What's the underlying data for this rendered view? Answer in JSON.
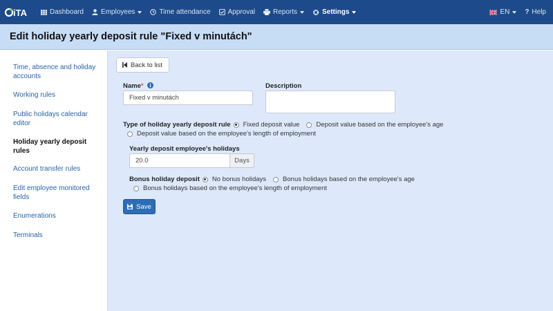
{
  "nav": {
    "logo_text": "CiTA",
    "items": [
      {
        "label": "Dashboard"
      },
      {
        "label": "Employees"
      },
      {
        "label": "Time attendance"
      },
      {
        "label": "Approval"
      },
      {
        "label": "Reports"
      },
      {
        "label": "Settings"
      }
    ],
    "language": "EN",
    "help": "Help"
  },
  "header": {
    "title": "Edit holiday yearly deposit rule \"Fixed v minutách\""
  },
  "sidebar": {
    "items": [
      {
        "label": "Time, absence and holiday accounts"
      },
      {
        "label": "Working rules"
      },
      {
        "label": "Public holidays calendar editor"
      },
      {
        "label": "Holiday yearly deposit rules"
      },
      {
        "label": "Account transfer rules"
      },
      {
        "label": "Edit employee monitored fields"
      },
      {
        "label": "Enumerations"
      },
      {
        "label": "Terminals"
      }
    ]
  },
  "form": {
    "back_label": "Back to list",
    "name_label": "Name",
    "required_mark": "*",
    "name_value": "Fixed v minutách",
    "description_label": "Description",
    "description_value": "",
    "rule_type_label": "Type of holiday yearly deposit rule",
    "rule_type_options": [
      "Fixed deposit value",
      "Deposit value based on the employee's age",
      "Deposit value based on the employee's length of employment"
    ],
    "rule_type_selected": 0,
    "yearly_label": "Yearly deposit employee's holidays",
    "yearly_value": "20.0",
    "yearly_unit": "Days",
    "bonus_label": "Bonus holiday deposit",
    "bonus_options": [
      "No bonus holidays",
      "Bonus holidays based on the employee's age",
      "Bonus holidays based on the employee's length of employment"
    ],
    "bonus_selected": 0,
    "save_label": "Save"
  },
  "colors": {
    "navbar": "#1d4a8a",
    "header": "#c7dcf5",
    "main_bg": "#dde9fb",
    "link": "#2a62a8",
    "primary_button": "#2d6db5"
  },
  "icons": {
    "dashboard": "grid-icon",
    "employees": "user-icon",
    "time_attendance": "clock-icon",
    "approval": "check-square-icon",
    "reports": "printer-icon",
    "settings": "gear-icon",
    "help": "question-icon",
    "back": "step-backward-icon",
    "save": "floppy-icon",
    "info": "info-circle-icon"
  }
}
